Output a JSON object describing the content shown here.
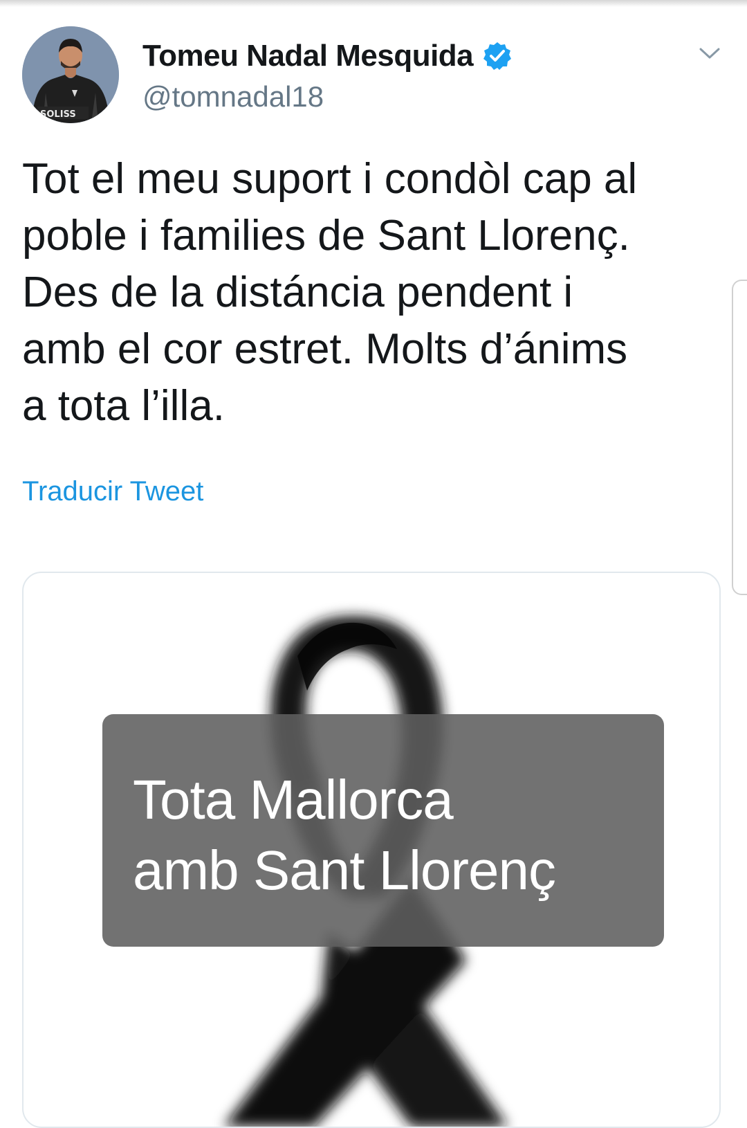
{
  "tweet": {
    "author_name": "Tomeu Nadal Mesquida",
    "handle": "@tomnadal18",
    "verified": true,
    "avatar_jersey_text": "SOLISS",
    "text_lines": [
      "Tot el meu suport i condòl cap al",
      "poble i families de Sant Llorenç.",
      "Des de la distáncia pendent i",
      "amb el cor estret. Molts d’ánims",
      "a tota l’illa."
    ],
    "translate_label": "Traducir Tweet"
  },
  "media": {
    "banner_lines": [
      "Tota Mallorca",
      "amb Sant Llorenç"
    ]
  },
  "icons": {
    "verified": "verified-badge-icon",
    "menu": "chevron-down-icon",
    "media": "black-mourning-ribbon"
  },
  "colors": {
    "link": "#1b95e0",
    "verified": "#1da1f2",
    "handle": "#657786",
    "text": "#14171a",
    "banner": "#5f5f5f"
  }
}
